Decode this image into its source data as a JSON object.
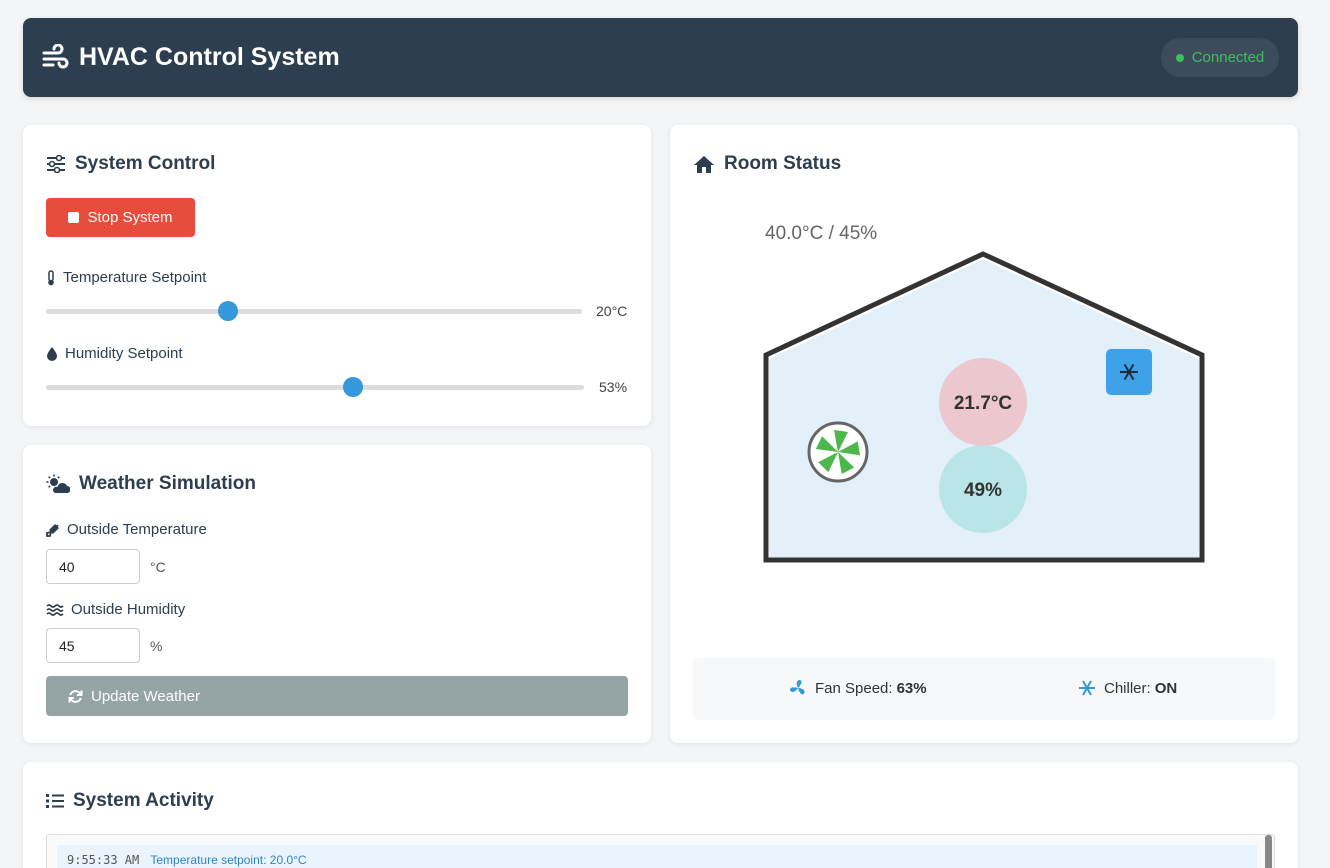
{
  "header": {
    "title": "HVAC Control System",
    "status": "Connected"
  },
  "system_control": {
    "title": "System Control",
    "stop_button": "Stop System",
    "temperature": {
      "label": "Temperature Setpoint",
      "value": "20°C",
      "fraction": 0.34
    },
    "humidity": {
      "label": "Humidity Setpoint",
      "value": "53%",
      "fraction": 0.57
    }
  },
  "weather": {
    "title": "Weather Simulation",
    "outside_temp_label": "Outside Temperature",
    "outside_temp_value": "40",
    "outside_temp_unit": "°C",
    "outside_humidity_label": "Outside Humidity",
    "outside_humidity_value": "45",
    "outside_humidity_unit": "%",
    "update_button": "Update Weather"
  },
  "room": {
    "title": "Room Status",
    "outside_reading": "40.0°C / 45%",
    "indoor_temp": "21.7°C",
    "indoor_humidity": "49%",
    "fan_label": "Fan Speed:",
    "fan_value": "63%",
    "chiller_label": "Chiller:",
    "chiller_value": "ON"
  },
  "activity": {
    "title": "System Activity",
    "entries": [
      {
        "time": "9:55:33 AM",
        "message": "Temperature setpoint: 20.0°C"
      }
    ]
  },
  "colors": {
    "header_bg": "#2c3e50",
    "accent": "#3498db",
    "stop": "#e74c3c",
    "connected": "#3bc15a",
    "fan": "#4cb84c",
    "temp_bubble": "#ecc7cd",
    "humidity_bubble": "#b9e4e8"
  },
  "icons": [
    "wind-icon",
    "sliders-icon",
    "thermometer-icon",
    "droplet-icon",
    "cloud-sun-icon",
    "temperature-high-icon",
    "water-icon",
    "sync-icon",
    "home-icon",
    "fan-icon",
    "snowflake-icon",
    "list-icon"
  ]
}
